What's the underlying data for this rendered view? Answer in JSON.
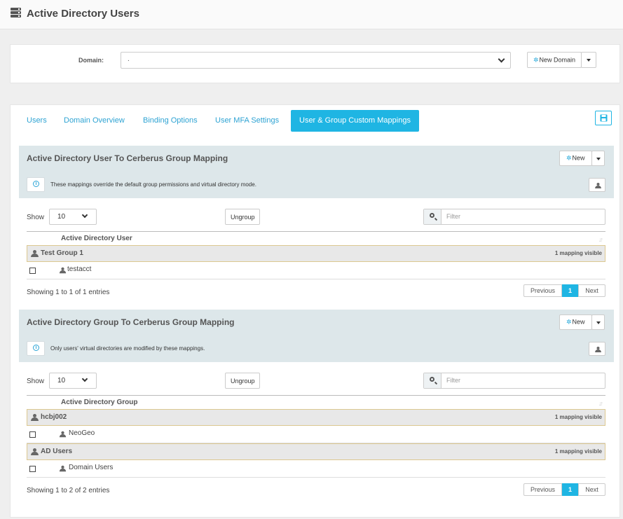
{
  "app": {
    "title": "Active Directory Users",
    "icon": "server-icon"
  },
  "domain": {
    "label": "Domain:",
    "selected": ".",
    "new_domain_label": "New Domain"
  },
  "tabs": [
    {
      "label": "Users",
      "active": false
    },
    {
      "label": "Domain Overview",
      "active": false
    },
    {
      "label": "Binding Options",
      "active": false
    },
    {
      "label": "User MFA Settings",
      "active": false
    },
    {
      "label": "User & Group Custom Mappings",
      "active": true
    }
  ],
  "colors": {
    "accent": "#1fb5e3",
    "link": "#2ea3d3",
    "section_bg": "#dde7ea",
    "group_border": "#dcc890"
  },
  "user_mapping": {
    "title": "Active Directory User To Cerberus Group Mapping",
    "new_label": "New",
    "info": "These mappings override the default group permissions and virtual directory mode.",
    "show_label": "Show",
    "page_size": "10",
    "ungroup_label": "Ungroup",
    "filter_placeholder": "Filter",
    "column_header": "Active Directory User",
    "groups": [
      {
        "name": "Test Group 1",
        "count": "1 mapping visible",
        "items": [
          "testacct"
        ]
      }
    ],
    "showing": "Showing 1 to 1 of 1 entries",
    "pager": {
      "prev": "Previous",
      "page": "1",
      "next": "Next"
    }
  },
  "group_mapping": {
    "title": "Active Directory Group To Cerberus Group Mapping",
    "new_label": "New",
    "info": "Only users' virtual directories are modified by these mappings.",
    "show_label": "Show",
    "page_size": "10",
    "ungroup_label": "Ungroup",
    "filter_placeholder": "Filter",
    "column_header": "Active Directory Group",
    "groups": [
      {
        "name": "hcbj002",
        "count": "1 mapping visible",
        "items": [
          "NeoGeo"
        ]
      },
      {
        "name": "AD Users",
        "count": "1 mapping visible",
        "items": [
          "Domain Users"
        ]
      }
    ],
    "showing": "Showing 1 to 2 of 2 entries",
    "pager": {
      "prev": "Previous",
      "page": "1",
      "next": "Next"
    }
  }
}
